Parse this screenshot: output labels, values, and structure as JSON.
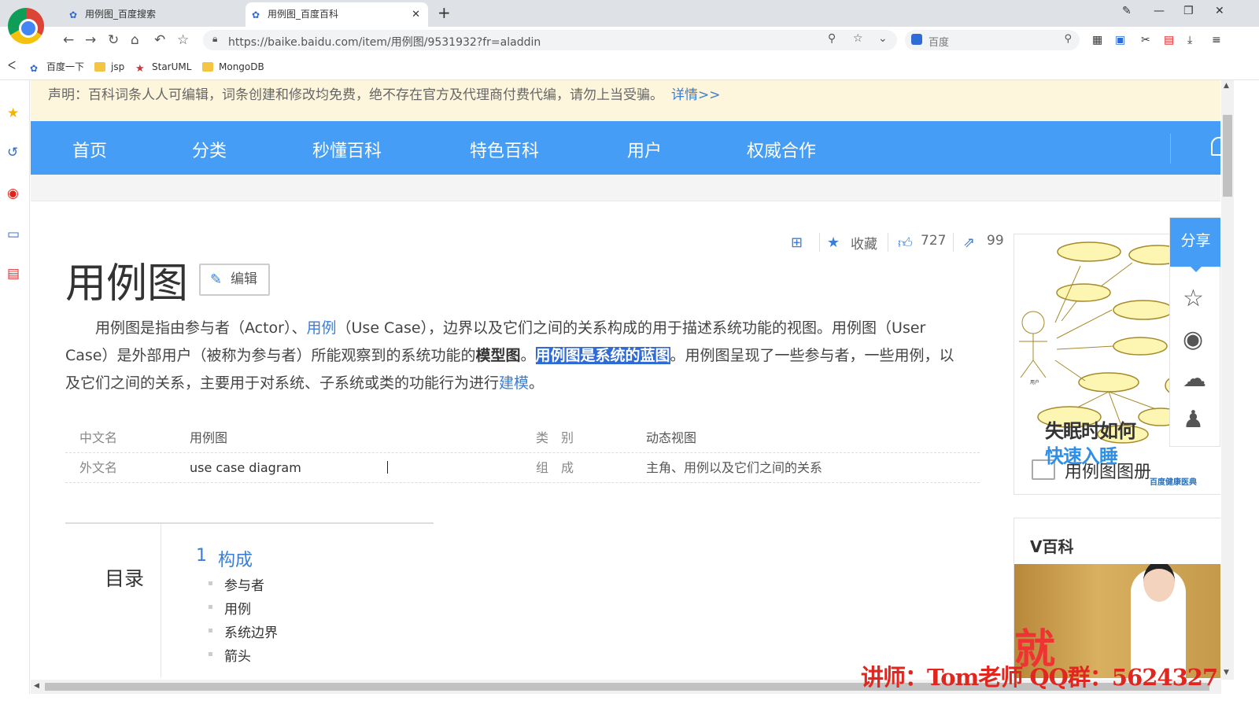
{
  "browser": {
    "tabs": [
      {
        "label": "用例图_百度搜索",
        "active": false
      },
      {
        "label": "用例图_百度百科",
        "active": true
      }
    ],
    "new_tab": "+",
    "url": "https://baike.baidu.com/item/用例图/9531932?fr=aladdin",
    "search_engine_label": "百度",
    "bookmarks": [
      {
        "label": "百度一下"
      },
      {
        "label": "jsp"
      },
      {
        "label": "StarUML"
      },
      {
        "label": "MongoDB"
      }
    ]
  },
  "notice": {
    "text": "声明：百科词条人人可编辑，词条创建和修改均免费，绝不存在官方及代理商付费代编，请勿上当受骗。",
    "link": "详情>>"
  },
  "nav": {
    "items": [
      "首页",
      "分类",
      "秒懂百科",
      "特色百科",
      "用户",
      "权威合作"
    ]
  },
  "actions": {
    "collect_label": "收藏",
    "likes": "727",
    "shares": "99"
  },
  "article": {
    "title": "用例图",
    "edit_label": "编辑",
    "p1": "用例图是指由参与者（Actor）、",
    "p1_link": "用例",
    "p2": "（Use Case），边界以及它们之间的关系构成的用于描述系统功能的视图。用例图（User Case）是外部用户（被称为参与者）所能观察到的系统功能的",
    "p2_bold": "模型图",
    "p3": "。",
    "p3_highlight": "用例图是系统的蓝图",
    "p4": "。用例图呈现了一些参与者，一些用例，以及它们之间的关系，主要用于对系统、子系统或类的功能行为进行",
    "p4_link": "建模",
    "p5": "。"
  },
  "infobox": {
    "rows": [
      {
        "k1": "中文名",
        "v1": "用例图",
        "k2": "类　别",
        "v2": "动态视图"
      },
      {
        "k1": "外文名",
        "v1": "use case diagram",
        "k2": "组　成",
        "v2": "主角、用例以及它们之间的关系"
      }
    ]
  },
  "toc": {
    "title": "目录",
    "num": "1",
    "main": "构成",
    "subs": [
      "参与者",
      "用例",
      "系统边界",
      "箭头"
    ]
  },
  "album": {
    "caption": "用例图图册",
    "watermark": "百度健康医典"
  },
  "share": {
    "head": "分享"
  },
  "ad": {
    "label": "V百科",
    "line1": "失眠时如何",
    "line2": "快速入睡",
    "img_text": "就"
  },
  "overlay": {
    "teacher": "讲师：Tom老师 QQ群：5624327"
  },
  "colors": {
    "nav_blue": "#459df5",
    "link_blue": "#3a7ed6",
    "highlight": "#2f6bd6",
    "notice_bg": "#fdf6dd",
    "overlay_red": "#e0261e"
  }
}
